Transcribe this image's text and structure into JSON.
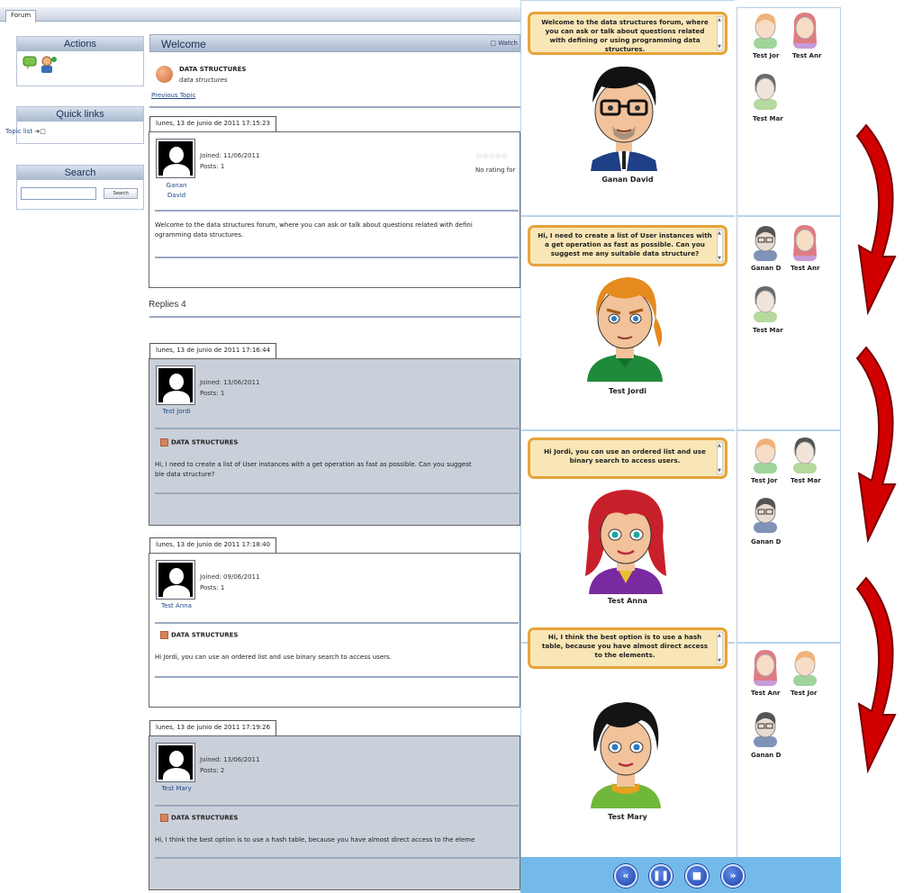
{
  "forum": {
    "tab": "Forum",
    "actions_title": "Actions",
    "quick_links_title": "Quick links",
    "topic_list_label": "Topic list",
    "search_title": "Search",
    "search_button": "Search",
    "welcome_title": "Welcome",
    "watch_label": "Watch",
    "topic_title": "DATA STRUCTURES",
    "topic_subtitle": "data structures",
    "previous_topic": "Previous Topic",
    "replies_label": "Replies 4",
    "rating_text": "No rating for",
    "posts": [
      {
        "date": "lunes, 13 de junio de 2011 17:15:23",
        "author_line1": "Ganan",
        "author_line2": "David",
        "joined": "Joined: 11/06/2011",
        "posts": "Posts: 1",
        "body": "Welcome to the data structures forum, where you can ask or talk about questions related with defini",
        "body2": "ogramming data structures."
      },
      {
        "date": "lunes, 13 de junio de 2011 17:16:44",
        "author": "Test Jordi",
        "joined": "Joined: 13/06/2011",
        "posts": "Posts: 1",
        "subject": "DATA STRUCTURES",
        "body": "Hi, I need to create a list of User instances with a get operation as fast as possible. Can you suggest",
        "body2": "ble data structure?"
      },
      {
        "date": "lunes, 13 de junio de 2011 17:18:40",
        "author": "Test Anna",
        "joined": "Joined: 09/06/2011",
        "posts": "Posts: 1",
        "subject": "DATA STRUCTURES",
        "body": "Hi Jordi, you can use an ordered list and use binary search to access users."
      },
      {
        "date": "lunes, 13 de junio de 2011 17:19:26",
        "author": "Test Mary",
        "joined": "Joined: 13/06/2011",
        "posts": "Posts: 2",
        "subject": "DATA STRUCTURES",
        "body": "Hi, I think the best option is to use a hash table, because you have almost direct access to the eleme"
      }
    ]
  },
  "chat": {
    "frames": [
      {
        "bubble": "Welcome to the data structures forum, where you can ask or talk about questions related with defining or using programming data structures.",
        "speaker": "Ganan David",
        "listeners": [
          "Test Jor",
          "Test Anr",
          "Test Mar"
        ]
      },
      {
        "bubble": "Hi, I need to create a list of User instances with a get operation as fast as possible. Can you suggest me any suitable data structure?",
        "speaker": "Test Jordi",
        "listeners": [
          "Ganan D",
          "Test Anr",
          "Test Mar"
        ]
      },
      {
        "bubble": "Hi Jordi, you can use an ordered list and use binary search to access users.",
        "speaker": "Test Anna",
        "listeners": [
          "Test Jor",
          "Test Mar",
          "Ganan D"
        ]
      },
      {
        "bubble": "Hi, I think the best option is to use a hash table, because you have almost direct access to the elements.",
        "speaker": "Test Mary",
        "listeners": [
          "Test Anr",
          "Test Jor",
          "Ganan D"
        ]
      }
    ],
    "controls": [
      "rewind-icon",
      "pause-icon",
      "stop-icon",
      "fast-forward-icon"
    ]
  },
  "colors": {
    "bubble_bg": "#f9e6b6",
    "bubble_border": "#e6a33a",
    "control_bar": "#74bae8",
    "arrow_red": "#d10000"
  }
}
